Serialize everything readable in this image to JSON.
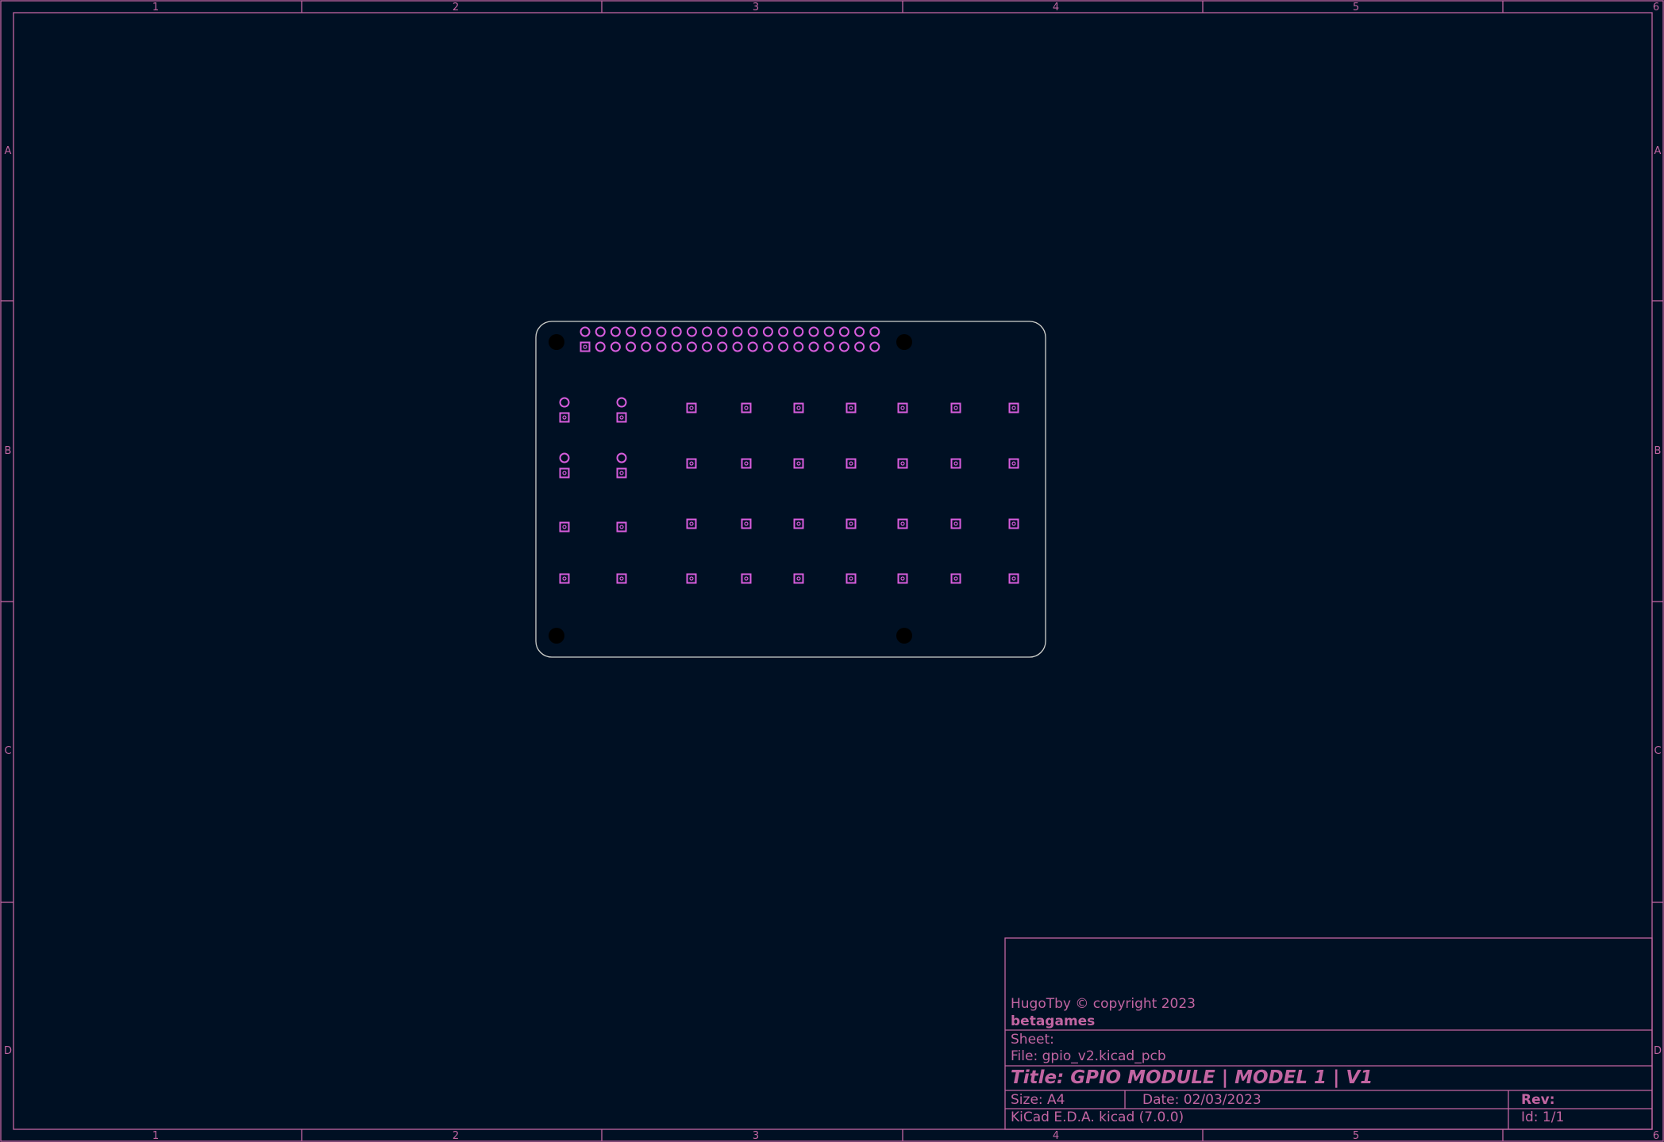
{
  "colors": {
    "background": "#001023",
    "frame": "#c265a2",
    "edge_cuts": "#d0d2cd",
    "pads": "#d85ddd",
    "holes": "#000000"
  },
  "border": {
    "columns": [
      "1",
      "2",
      "3",
      "4",
      "5",
      "6"
    ],
    "rows": [
      "A",
      "B",
      "C",
      "D"
    ]
  },
  "title_block": {
    "copyright": "HugoTby © copyright 2023",
    "company": "betagames",
    "sheet": "Sheet:",
    "file": "File: gpio_v2.kicad_pcb",
    "title": "Title: GPIO MODULE  |  MODEL 1  |  V1",
    "size": "Size: A4",
    "date": "Date: 02/03/2023",
    "rev": "Rev:",
    "tool": "KiCad E.D.A.  kicad (7.0.0)",
    "id": "Id: 1/1"
  },
  "board": {
    "header_pins_per_row": 20,
    "button_columns": 7,
    "button_rows": 4,
    "mounting_holes": 4
  }
}
